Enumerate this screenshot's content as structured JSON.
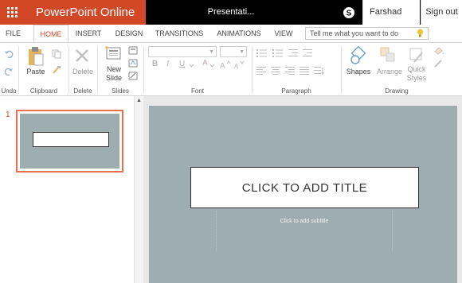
{
  "app": {
    "name": "PowerPoint Online",
    "document_title": "Presentati...",
    "user_name": "Farshad Iqbal",
    "sign_out": "Sign out",
    "brand_color": "#d24726"
  },
  "tabs": [
    {
      "label": "FILE",
      "active": false
    },
    {
      "label": "HOME",
      "active": true
    },
    {
      "label": "INSERT",
      "active": false
    },
    {
      "label": "DESIGN",
      "active": false
    },
    {
      "label": "TRANSITIONS",
      "active": false
    },
    {
      "label": "ANIMATIONS",
      "active": false
    },
    {
      "label": "VIEW",
      "active": false
    }
  ],
  "tell_me": {
    "placeholder": "Tell me what you want to do",
    "icon": "lightbulb-icon"
  },
  "ribbon": {
    "undo": {
      "group": "Undo",
      "icons": [
        "undo-icon",
        "redo-icon"
      ]
    },
    "clipboard": {
      "group": "Clipboard",
      "paste": "Paste",
      "icons": [
        "paste-icon",
        "copy-icon",
        "format-painter-icon"
      ]
    },
    "delete": {
      "group": "Delete",
      "label": "Delete",
      "icon": "delete-x-icon"
    },
    "slides": {
      "group": "Slides",
      "new_slide_line1": "New",
      "new_slide_line2": "Slide",
      "icons": [
        "new-slide-icon",
        "layout-icon",
        "reset-icon",
        "hide-slide-icon"
      ]
    },
    "font": {
      "group": "Font",
      "bold": "B",
      "italic": "I",
      "underline": "U",
      "font_color": "A"
    },
    "paragraph": {
      "group": "Paragraph"
    },
    "drawing": {
      "group": "Drawing",
      "shapes": "Shapes",
      "arrange": "Arrange",
      "quick_line1": "Quick",
      "quick_line2": "Styles"
    }
  },
  "slides_pane": {
    "slide_number": "1"
  },
  "slide": {
    "title_placeholder": "CLICK TO ADD TITLE",
    "subtitle_placeholder": "Click to add subtitle",
    "background_color": "#9eadb0"
  }
}
